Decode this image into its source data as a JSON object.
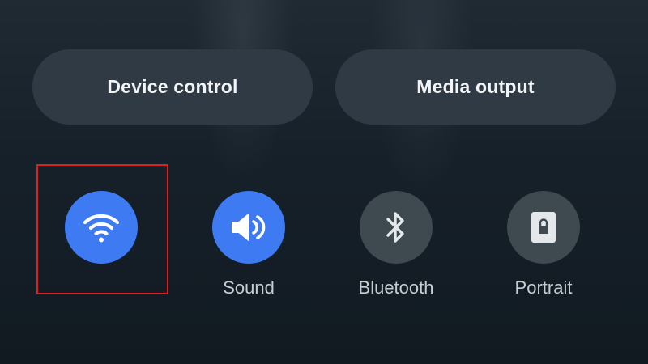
{
  "quick_panel": {
    "buttons": {
      "device_control": "Device control",
      "media_output": "Media output"
    },
    "tiles": [
      {
        "icon": "wifi-icon",
        "label": "",
        "state": "on"
      },
      {
        "icon": "volume-icon",
        "label": "Sound",
        "state": "on"
      },
      {
        "icon": "bluetooth-icon",
        "label": "Bluetooth",
        "state": "off"
      },
      {
        "icon": "portrait-lock-icon",
        "label": "Portrait",
        "state": "off"
      }
    ]
  },
  "colors": {
    "accent_active": "#3e7bf2",
    "tile_inactive": "#3f4950",
    "pill_background": "#2f3a44",
    "highlight_box": "#e01e1e"
  }
}
